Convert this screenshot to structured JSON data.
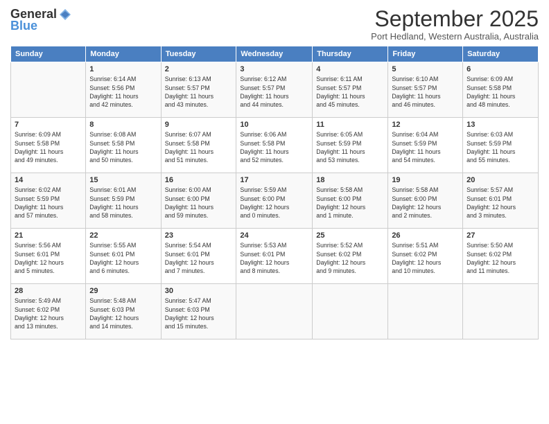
{
  "logo": {
    "general": "General",
    "blue": "Blue"
  },
  "title": "September 2025",
  "location": "Port Hedland, Western Australia, Australia",
  "weekdays": [
    "Sunday",
    "Monday",
    "Tuesday",
    "Wednesday",
    "Thursday",
    "Friday",
    "Saturday"
  ],
  "weeks": [
    [
      {
        "day": "",
        "info": ""
      },
      {
        "day": "1",
        "info": "Sunrise: 6:14 AM\nSunset: 5:56 PM\nDaylight: 11 hours\nand 42 minutes."
      },
      {
        "day": "2",
        "info": "Sunrise: 6:13 AM\nSunset: 5:57 PM\nDaylight: 11 hours\nand 43 minutes."
      },
      {
        "day": "3",
        "info": "Sunrise: 6:12 AM\nSunset: 5:57 PM\nDaylight: 11 hours\nand 44 minutes."
      },
      {
        "day": "4",
        "info": "Sunrise: 6:11 AM\nSunset: 5:57 PM\nDaylight: 11 hours\nand 45 minutes."
      },
      {
        "day": "5",
        "info": "Sunrise: 6:10 AM\nSunset: 5:57 PM\nDaylight: 11 hours\nand 46 minutes."
      },
      {
        "day": "6",
        "info": "Sunrise: 6:09 AM\nSunset: 5:58 PM\nDaylight: 11 hours\nand 48 minutes."
      }
    ],
    [
      {
        "day": "7",
        "info": "Sunrise: 6:09 AM\nSunset: 5:58 PM\nDaylight: 11 hours\nand 49 minutes."
      },
      {
        "day": "8",
        "info": "Sunrise: 6:08 AM\nSunset: 5:58 PM\nDaylight: 11 hours\nand 50 minutes."
      },
      {
        "day": "9",
        "info": "Sunrise: 6:07 AM\nSunset: 5:58 PM\nDaylight: 11 hours\nand 51 minutes."
      },
      {
        "day": "10",
        "info": "Sunrise: 6:06 AM\nSunset: 5:58 PM\nDaylight: 11 hours\nand 52 minutes."
      },
      {
        "day": "11",
        "info": "Sunrise: 6:05 AM\nSunset: 5:59 PM\nDaylight: 11 hours\nand 53 minutes."
      },
      {
        "day": "12",
        "info": "Sunrise: 6:04 AM\nSunset: 5:59 PM\nDaylight: 11 hours\nand 54 minutes."
      },
      {
        "day": "13",
        "info": "Sunrise: 6:03 AM\nSunset: 5:59 PM\nDaylight: 11 hours\nand 55 minutes."
      }
    ],
    [
      {
        "day": "14",
        "info": "Sunrise: 6:02 AM\nSunset: 5:59 PM\nDaylight: 11 hours\nand 57 minutes."
      },
      {
        "day": "15",
        "info": "Sunrise: 6:01 AM\nSunset: 5:59 PM\nDaylight: 11 hours\nand 58 minutes."
      },
      {
        "day": "16",
        "info": "Sunrise: 6:00 AM\nSunset: 6:00 PM\nDaylight: 11 hours\nand 59 minutes."
      },
      {
        "day": "17",
        "info": "Sunrise: 5:59 AM\nSunset: 6:00 PM\nDaylight: 12 hours\nand 0 minutes."
      },
      {
        "day": "18",
        "info": "Sunrise: 5:58 AM\nSunset: 6:00 PM\nDaylight: 12 hours\nand 1 minute."
      },
      {
        "day": "19",
        "info": "Sunrise: 5:58 AM\nSunset: 6:00 PM\nDaylight: 12 hours\nand 2 minutes."
      },
      {
        "day": "20",
        "info": "Sunrise: 5:57 AM\nSunset: 6:01 PM\nDaylight: 12 hours\nand 3 minutes."
      }
    ],
    [
      {
        "day": "21",
        "info": "Sunrise: 5:56 AM\nSunset: 6:01 PM\nDaylight: 12 hours\nand 5 minutes."
      },
      {
        "day": "22",
        "info": "Sunrise: 5:55 AM\nSunset: 6:01 PM\nDaylight: 12 hours\nand 6 minutes."
      },
      {
        "day": "23",
        "info": "Sunrise: 5:54 AM\nSunset: 6:01 PM\nDaylight: 12 hours\nand 7 minutes."
      },
      {
        "day": "24",
        "info": "Sunrise: 5:53 AM\nSunset: 6:01 PM\nDaylight: 12 hours\nand 8 minutes."
      },
      {
        "day": "25",
        "info": "Sunrise: 5:52 AM\nSunset: 6:02 PM\nDaylight: 12 hours\nand 9 minutes."
      },
      {
        "day": "26",
        "info": "Sunrise: 5:51 AM\nSunset: 6:02 PM\nDaylight: 12 hours\nand 10 minutes."
      },
      {
        "day": "27",
        "info": "Sunrise: 5:50 AM\nSunset: 6:02 PM\nDaylight: 12 hours\nand 11 minutes."
      }
    ],
    [
      {
        "day": "28",
        "info": "Sunrise: 5:49 AM\nSunset: 6:02 PM\nDaylight: 12 hours\nand 13 minutes."
      },
      {
        "day": "29",
        "info": "Sunrise: 5:48 AM\nSunset: 6:03 PM\nDaylight: 12 hours\nand 14 minutes."
      },
      {
        "day": "30",
        "info": "Sunrise: 5:47 AM\nSunset: 6:03 PM\nDaylight: 12 hours\nand 15 minutes."
      },
      {
        "day": "",
        "info": ""
      },
      {
        "day": "",
        "info": ""
      },
      {
        "day": "",
        "info": ""
      },
      {
        "day": "",
        "info": ""
      }
    ]
  ]
}
